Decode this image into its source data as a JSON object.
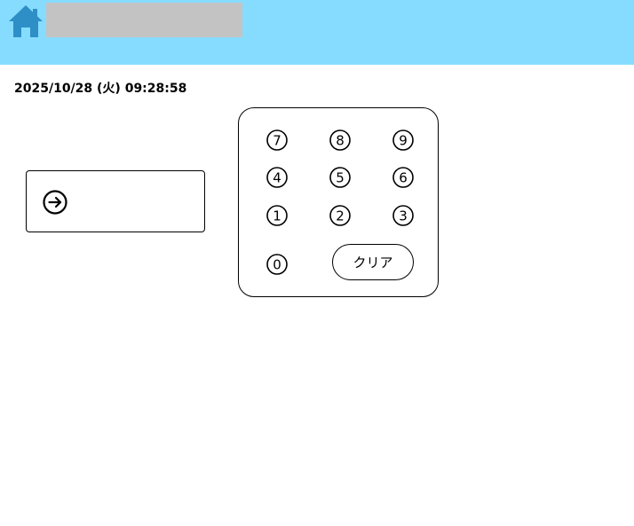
{
  "header": {
    "background_color": "#86dcfe",
    "home_icon": "home-icon",
    "home_icon_color": "#2e8fc7",
    "title_placeholder_color": "#c3c3c3"
  },
  "datetime": "2025/10/28 (火) 09:28:58",
  "entry": {
    "icon": "arrow-right-circle-icon"
  },
  "keypad": {
    "keys": [
      "7",
      "8",
      "9",
      "4",
      "5",
      "6",
      "1",
      "2",
      "3",
      "0"
    ],
    "clear_label": "クリア"
  }
}
